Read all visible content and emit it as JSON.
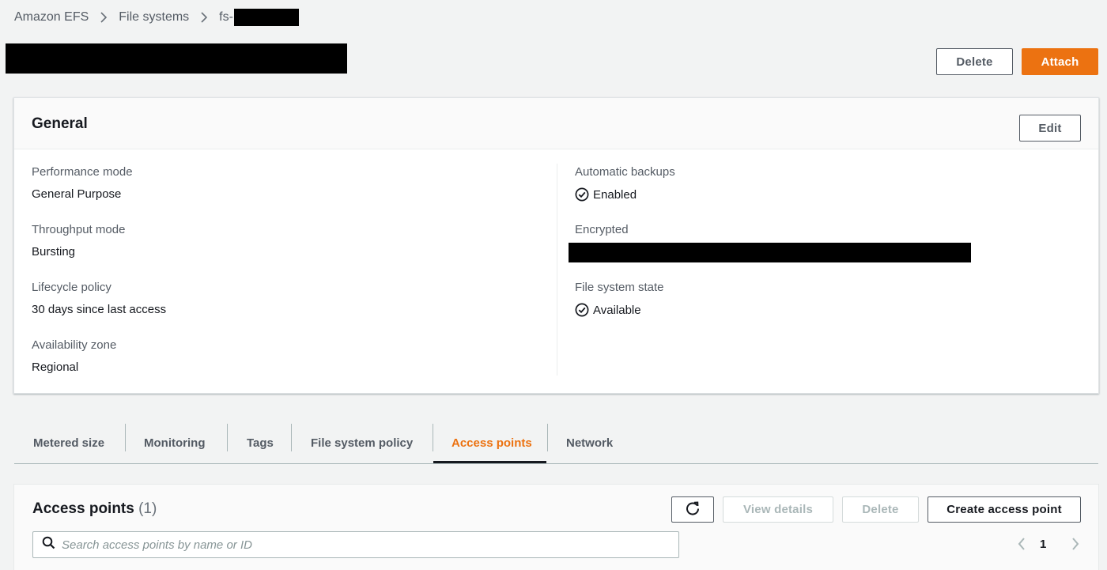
{
  "breadcrumb": {
    "items": [
      "Amazon EFS",
      "File systems",
      "fs-"
    ]
  },
  "header": {
    "delete_label": "Delete",
    "attach_label": "Attach"
  },
  "general": {
    "title": "General",
    "edit_label": "Edit",
    "left": [
      {
        "label": "Performance mode",
        "value": "General Purpose"
      },
      {
        "label": "Throughput mode",
        "value": "Bursting"
      },
      {
        "label": "Lifecycle policy",
        "value": "30 days since last access"
      },
      {
        "label": "Availability zone",
        "value": "Regional"
      }
    ],
    "right": [
      {
        "label": "Automatic backups",
        "value": "Enabled",
        "icon": "check-circle-icon"
      },
      {
        "label": "Encrypted",
        "value": ""
      },
      {
        "label": "File system state",
        "value": "Available",
        "icon": "check-circle-icon"
      }
    ]
  },
  "tabs": [
    {
      "label": "Metered size",
      "active": false
    },
    {
      "label": "Monitoring",
      "active": false
    },
    {
      "label": "Tags",
      "active": false
    },
    {
      "label": "File system policy",
      "active": false
    },
    {
      "label": "Access points",
      "active": true
    },
    {
      "label": "Network",
      "active": false
    }
  ],
  "access_points": {
    "title": "Access points",
    "count": "(1)",
    "refresh_icon": "refresh-icon",
    "view_details_label": "View details",
    "delete_label": "Delete",
    "create_label": "Create access point",
    "search_placeholder": "Search access points by name or ID",
    "search_value": "",
    "current_page": "1"
  },
  "colors": {
    "accent": "#ec7211",
    "background": "#f2f3f3",
    "text": "#16191f",
    "muted": "#545b64"
  }
}
